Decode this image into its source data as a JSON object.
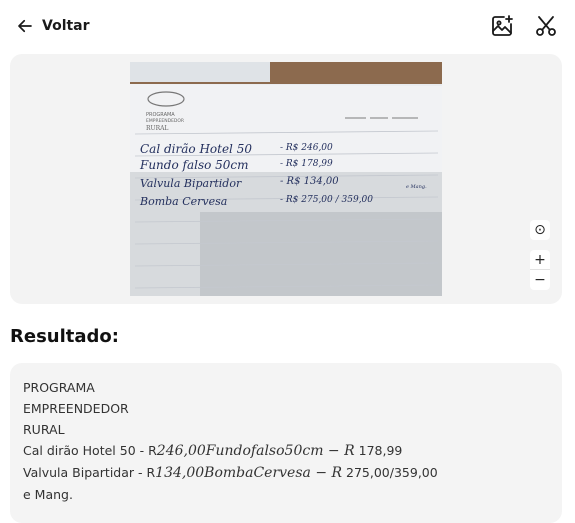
{
  "header": {
    "back_label": "Voltar",
    "icons": [
      "arrow-left-icon",
      "image-plus-icon",
      "scissors-icon"
    ]
  },
  "viewer": {
    "photo_text": {
      "logo_line1": "PROGRAMA",
      "logo_line2": "EMPREENDEDOR",
      "logo_line3": "RURAL",
      "row1_item": "Cal dirão Hotel 50",
      "row1_price": "- R$ 246,00",
      "row2_item": "Fundo falso 50cm",
      "row2_price": "- R$ 178,99",
      "row3_item": "Valvula Bipartidor",
      "row3_price": "- R$ 134,00",
      "row4_item": "Bomba Cervesa",
      "row4_price": "- R$ 275,00 / 359,00",
      "row4_note": "e Mang."
    },
    "tools": {
      "center": "⊙",
      "zoom_in": "+",
      "zoom_out": "−"
    }
  },
  "result": {
    "title": "Resultado:",
    "lines": [
      {
        "text": "PROGRAMA"
      },
      {
        "text": "EMPREENDEDOR"
      },
      {
        "text": "RURAL"
      },
      {
        "pre": "Cal dirão Hotel 50 - R",
        "math": "246,00Fundofalso50cm − R",
        "post": " 178,99"
      },
      {
        "pre": "Valvula Bipartidar - R",
        "math": "134,00BombaCervesa − R",
        "post": " 275,00/359,00"
      },
      {
        "text": "e Mang."
      }
    ]
  }
}
